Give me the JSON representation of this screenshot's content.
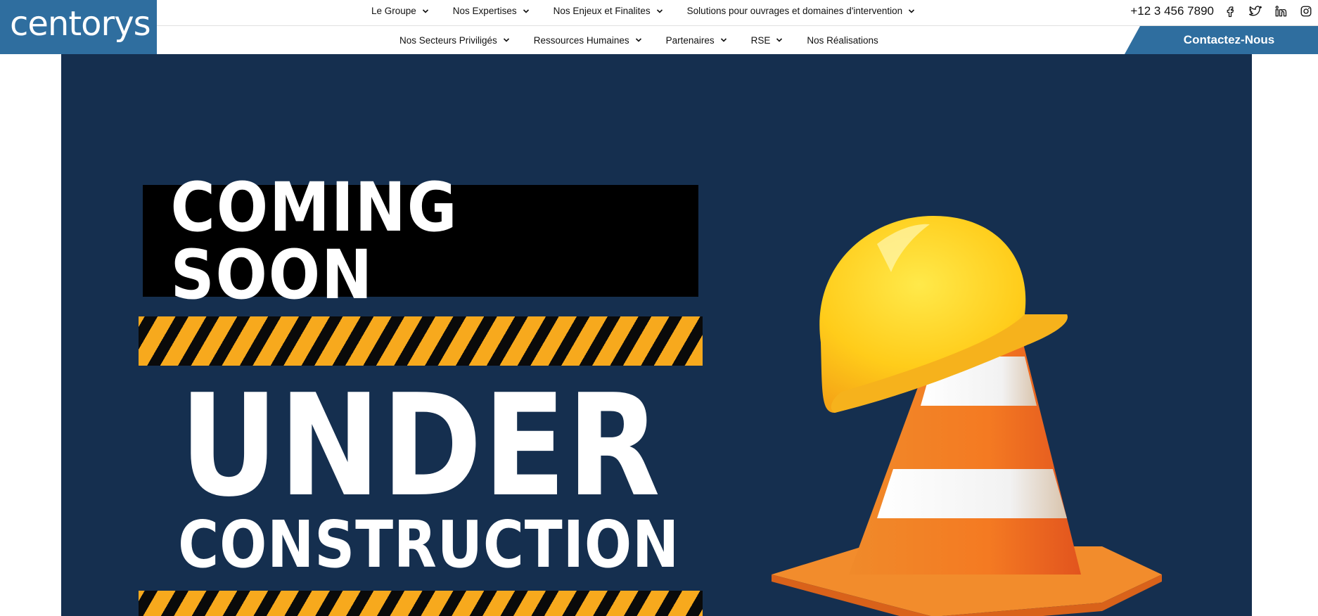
{
  "brand": {
    "logo_text": "centorys",
    "color": "#2f6e9f"
  },
  "top_nav": {
    "items": [
      {
        "label": "Le Groupe"
      },
      {
        "label": "Nos Expertises"
      },
      {
        "label": "Nos Enjeux et Finalites"
      },
      {
        "label": "Solutions pour ouvrages et domaines d'intervention"
      }
    ]
  },
  "contact": {
    "phone": "+12 3 456 7890",
    "socials": [
      "facebook-icon",
      "twitter-icon",
      "linkedin-icon",
      "instagram-icon"
    ]
  },
  "sub_nav": {
    "items": [
      {
        "label": "Nos Secteurs Priviligés",
        "dropdown": true
      },
      {
        "label": "Ressources Humaines",
        "dropdown": true
      },
      {
        "label": "Partenaires",
        "dropdown": true
      },
      {
        "label": "RSE",
        "dropdown": true
      },
      {
        "label": "Nos Réalisations",
        "dropdown": false
      }
    ]
  },
  "cta": {
    "label": "Contactez-Nous"
  },
  "hero": {
    "coming_soon": "COMING SOON",
    "under": "UNDER",
    "construction": "CONSTRUCTION",
    "background_color": "#152f4f",
    "stripe_colors": [
      "#f7a91d",
      "#0a0a0a"
    ]
  }
}
